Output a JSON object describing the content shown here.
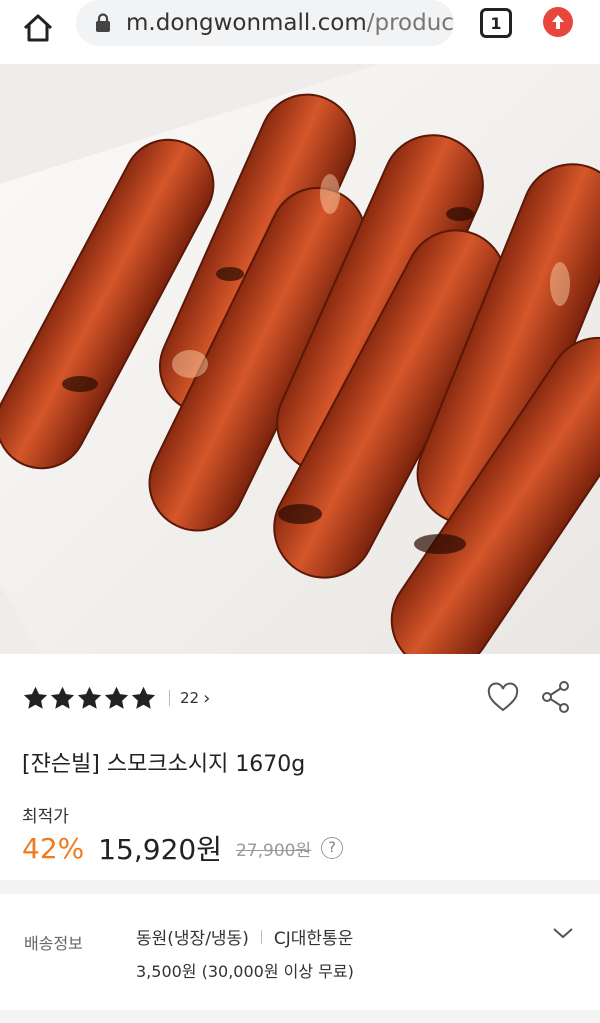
{
  "browser": {
    "url_domain": "m.dongwonmall.com",
    "url_path": "/produc",
    "tab_count": "1",
    "icons": [
      "home-icon",
      "lock-icon",
      "tabs-icon",
      "upgrade-icon"
    ]
  },
  "product": {
    "image_alt": "grilled smoked sausages on a white plate",
    "rating_stars": 5,
    "review_count": "22",
    "title": "[쟌슨빌] 스모크소시지 1670g",
    "lowest_label": "최적가",
    "discount": "42%",
    "price": "15,920원",
    "original_price": "27,900원",
    "help": "?"
  },
  "shipping": {
    "label": "배송정보",
    "seller": "동원(냉장/냉동)",
    "carrier": "CJ대한통운",
    "fee": "3,500원 (30,000원 이상 무료)"
  },
  "colors": {
    "accent_discount": "#f07a1e",
    "upgrade_red": "#e8453c"
  }
}
